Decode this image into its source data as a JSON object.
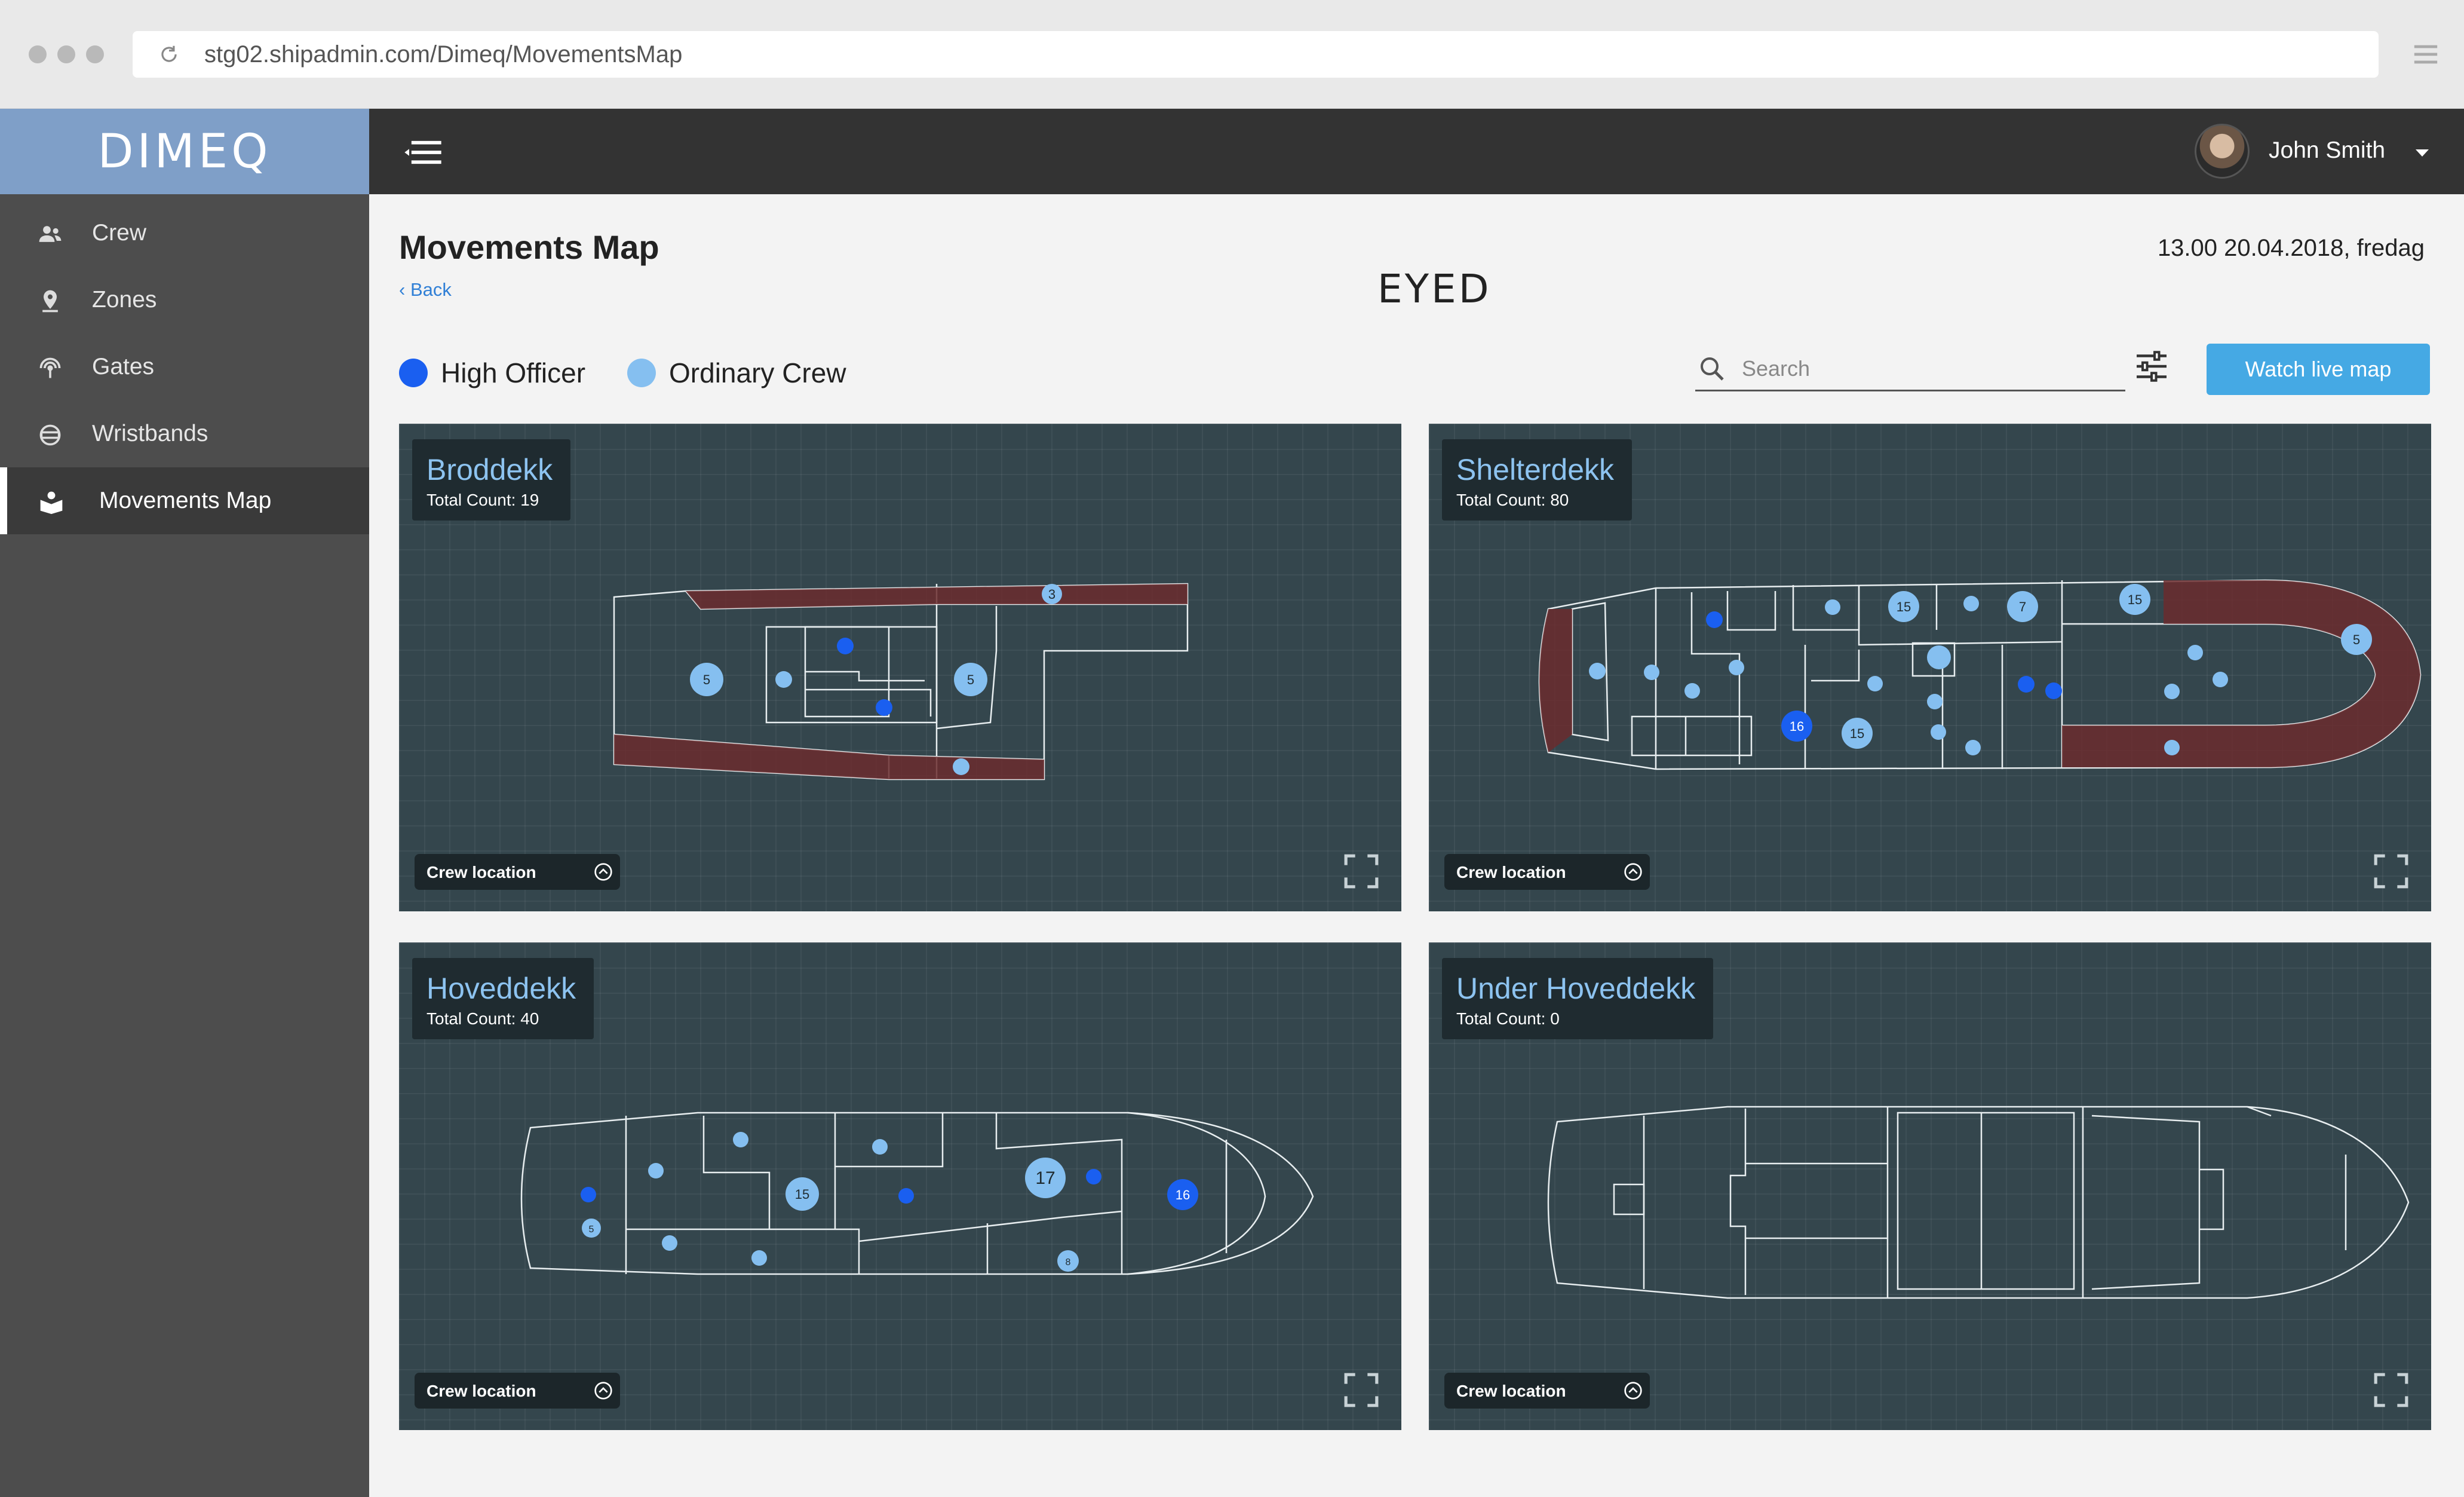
{
  "browser": {
    "url": "stg02.shipadmin.com/Dimeq/MovementsMap"
  },
  "brand": {
    "name": "DIMEQ"
  },
  "sidebar": {
    "items": [
      {
        "label": "Crew",
        "icon": "users-icon"
      },
      {
        "label": "Zones",
        "icon": "map-pin-icon"
      },
      {
        "label": "Gates",
        "icon": "signal-icon"
      },
      {
        "label": "Wristbands",
        "icon": "wristband-icon"
      },
      {
        "label": "Movements Map",
        "icon": "map-book-icon",
        "active": true
      }
    ]
  },
  "header": {
    "user_name": "John Smith"
  },
  "page": {
    "title": "Movements Map",
    "back_label": "Back",
    "logo_text": "EYED",
    "datetime": "13.00 20.04.2018, fredag"
  },
  "legend": {
    "high_officer": {
      "label": "High Officer",
      "color": "#1a5ff0"
    },
    "ordinary_crew": {
      "label": "Ordinary Crew",
      "color": "#85bff0"
    }
  },
  "search": {
    "placeholder": "Search",
    "value": ""
  },
  "toolbar": {
    "watch_label": "Watch live map"
  },
  "decks": [
    {
      "name": "Broddekk",
      "count_label": "Total Count: 19",
      "crew_location_label": "Crew location",
      "markers": [
        {
          "type": "ordinary",
          "count": "3"
        },
        {
          "type": "ordinary",
          "count": "5"
        },
        {
          "type": "ordinary",
          "count": "5"
        },
        {
          "type": "officer"
        },
        {
          "type": "officer"
        },
        {
          "type": "ordinary"
        },
        {
          "type": "ordinary"
        }
      ]
    },
    {
      "name": "Shelterdekk",
      "count_label": "Total Count: 80",
      "crew_location_label": "Crew location",
      "markers": [
        {
          "type": "ordinary",
          "count": "15"
        },
        {
          "type": "ordinary",
          "count": "15"
        },
        {
          "type": "ordinary",
          "count": "7"
        },
        {
          "type": "ordinary",
          "count": "5"
        },
        {
          "type": "officer",
          "count": "16"
        },
        {
          "type": "ordinary",
          "count": "15"
        },
        {
          "type": "officer"
        },
        {
          "type": "officer"
        },
        {
          "type": "officer"
        }
      ]
    },
    {
      "name": "Hoveddekk",
      "count_label": "Total Count: 40",
      "crew_location_label": "Crew location",
      "markers": [
        {
          "type": "ordinary",
          "count": "15"
        },
        {
          "type": "ordinary",
          "count": "17"
        },
        {
          "type": "officer",
          "count": "16"
        },
        {
          "type": "ordinary",
          "count": "5"
        },
        {
          "type": "ordinary",
          "count": "8"
        },
        {
          "type": "officer"
        },
        {
          "type": "officer"
        },
        {
          "type": "officer"
        }
      ]
    },
    {
      "name": "Under Hoveddekk",
      "count_label": "Total Count: 0",
      "crew_location_label": "Crew location",
      "markers": []
    }
  ]
}
